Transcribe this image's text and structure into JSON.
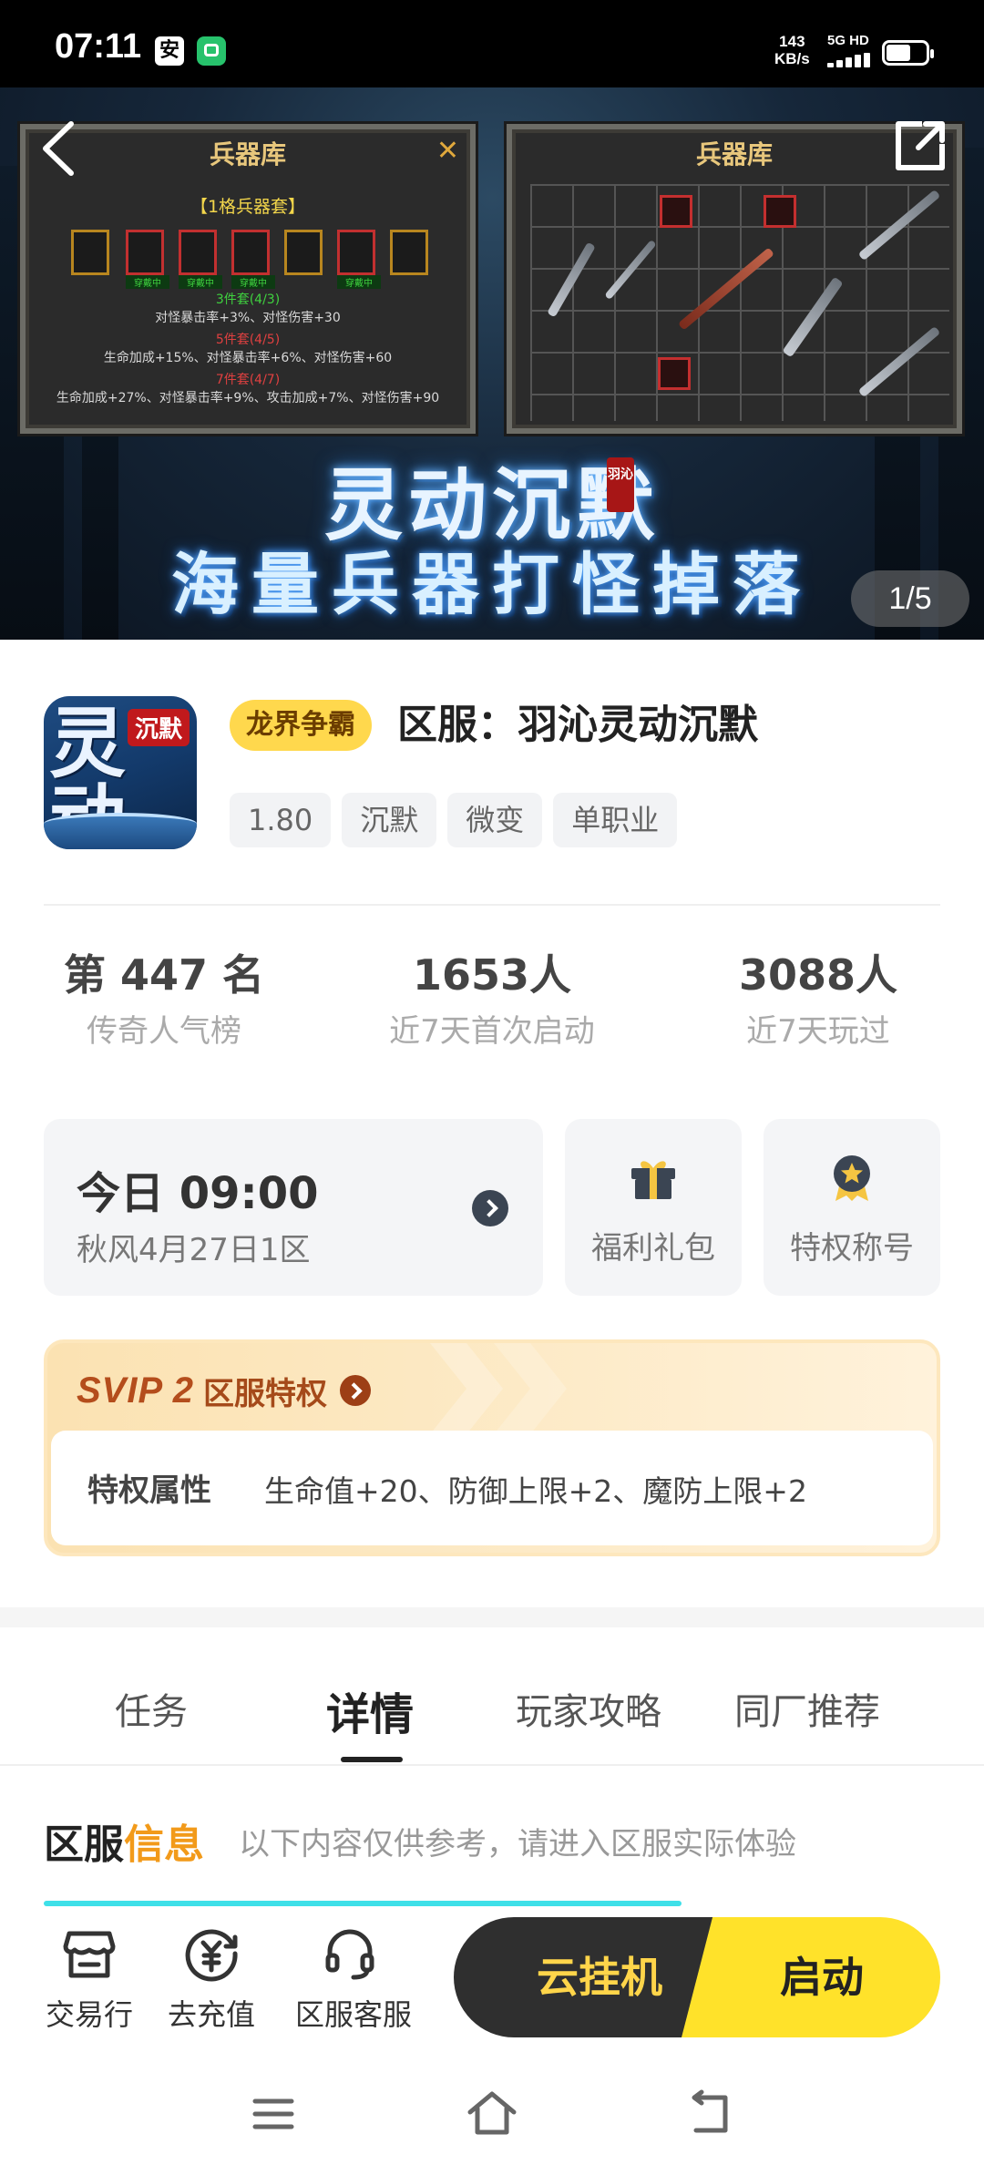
{
  "status_bar": {
    "time": "07:11",
    "speed_value": "143",
    "speed_unit": "KB/s",
    "network": "5G HD",
    "icons": [
      "notification-icon",
      "wechat-icon",
      "signal-icon",
      "battery-icon"
    ]
  },
  "banner": {
    "left_panel_title": "兵器库",
    "right_panel_title": "兵器库",
    "set_header": "【1格兵器套】",
    "slot_tag": "穿戴中",
    "set_lines": [
      {
        "text": "3件套(4/3)",
        "color": "green"
      },
      {
        "text": "对怪暴击率+3%、对怪伤害+30",
        "color": "white"
      },
      {
        "text": "5件套(4/5)",
        "color": "red"
      },
      {
        "text": "生命加成+15%、对怪暴击率+6%、对怪伤害+60",
        "color": "white"
      },
      {
        "text": "7件套(4/7)",
        "color": "red"
      },
      {
        "text": "生命加成+27%、对怪暴击率+9%、攻击加成+7%、对怪伤害+90",
        "color": "white"
      }
    ],
    "game_logo": "灵动沉默",
    "logo_seal": "羽沁",
    "slogan": "海量兵器打怪掉落",
    "pager": "1/5"
  },
  "app": {
    "icon_text": "灵动",
    "icon_tag": "沉默",
    "badge": "龙界争霸",
    "server_title": "区服：羽沁灵动沉默",
    "tags": [
      "1.80",
      "沉默",
      "微变",
      "单职业"
    ]
  },
  "stats": [
    {
      "value": "第 447 名",
      "label": "传奇人气榜"
    },
    {
      "value": "1653人",
      "label": "近7天首次启动"
    },
    {
      "value": "3088人",
      "label": "近7天玩过"
    }
  ],
  "open_card": {
    "time": "今日 09:00",
    "server": "秋风4月27日1区"
  },
  "quick_cards": [
    {
      "label": "福利礼包",
      "icon": "gift-icon"
    },
    {
      "label": "特权称号",
      "icon": "medal-icon"
    }
  ],
  "svip": {
    "level": "SVIP 2",
    "title": "区服特权",
    "key": "特权属性",
    "value": "生命值+20、防御上限+2、魔防上限+2"
  },
  "tabs": [
    "任务",
    "详情",
    "玩家攻略",
    "同厂推荐"
  ],
  "active_tab": "详情",
  "info": {
    "title_main": "区服",
    "title_hl": "信息",
    "note": "以下内容仅供参考，请进入区服实际体验"
  },
  "bottom_bar": {
    "items": [
      {
        "label": "交易行",
        "icon": "store-icon"
      },
      {
        "label": "去充值",
        "icon": "recharge-icon"
      },
      {
        "label": "区服客服",
        "icon": "headset-icon"
      }
    ],
    "cloud_button": "云挂机",
    "start_button": "启动"
  },
  "colors": {
    "accent_yellow": "#ffe22a",
    "dark_button": "#2f2f2f",
    "svip_orange": "#b44d1c",
    "progress_cyan": "#3fe0e8"
  }
}
